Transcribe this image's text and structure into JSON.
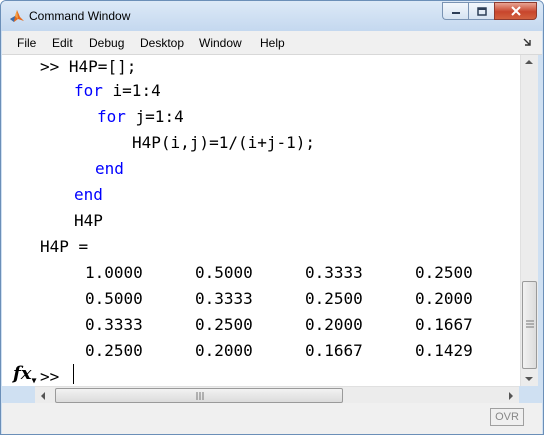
{
  "window": {
    "title": "Command Window",
    "controls": {
      "minimize": "minimize-icon",
      "maximize": "maximize-icon",
      "close": "close-icon"
    }
  },
  "menu": [
    {
      "label": "File"
    },
    {
      "label": "Edit"
    },
    {
      "label": "Debug"
    },
    {
      "label": "Desktop"
    },
    {
      "label": "Window"
    },
    {
      "label": "Help"
    }
  ],
  "console": {
    "lines": [
      {
        "prompt": ">> ",
        "code": "H4P=[];"
      },
      {
        "kw": "for",
        "code": " i=1:4"
      },
      {
        "kw": "for",
        "code": " j=1:4"
      },
      {
        "code": "H4P(i,j)=1/(i+j-1);"
      },
      {
        "kw": "end"
      },
      {
        "kw": "end"
      },
      {
        "code": "H4P"
      },
      {
        "code": "H4P ="
      }
    ],
    "matrix": [
      [
        "1.0000",
        "0.5000",
        "0.3333",
        "0.2500"
      ],
      [
        "0.5000",
        "0.3333",
        "0.2500",
        "0.2000"
      ],
      [
        "0.3333",
        "0.2500",
        "0.2000",
        "0.1667"
      ],
      [
        "0.2500",
        "0.2000",
        "0.1667",
        "0.1429"
      ]
    ],
    "fx_label": "fx",
    "prompt": ">>"
  },
  "status": {
    "ovr": "OVR"
  },
  "colors": {
    "keyword": "#0000ff",
    "titlebar": "#c4d8ef",
    "close": "#c8452c"
  }
}
